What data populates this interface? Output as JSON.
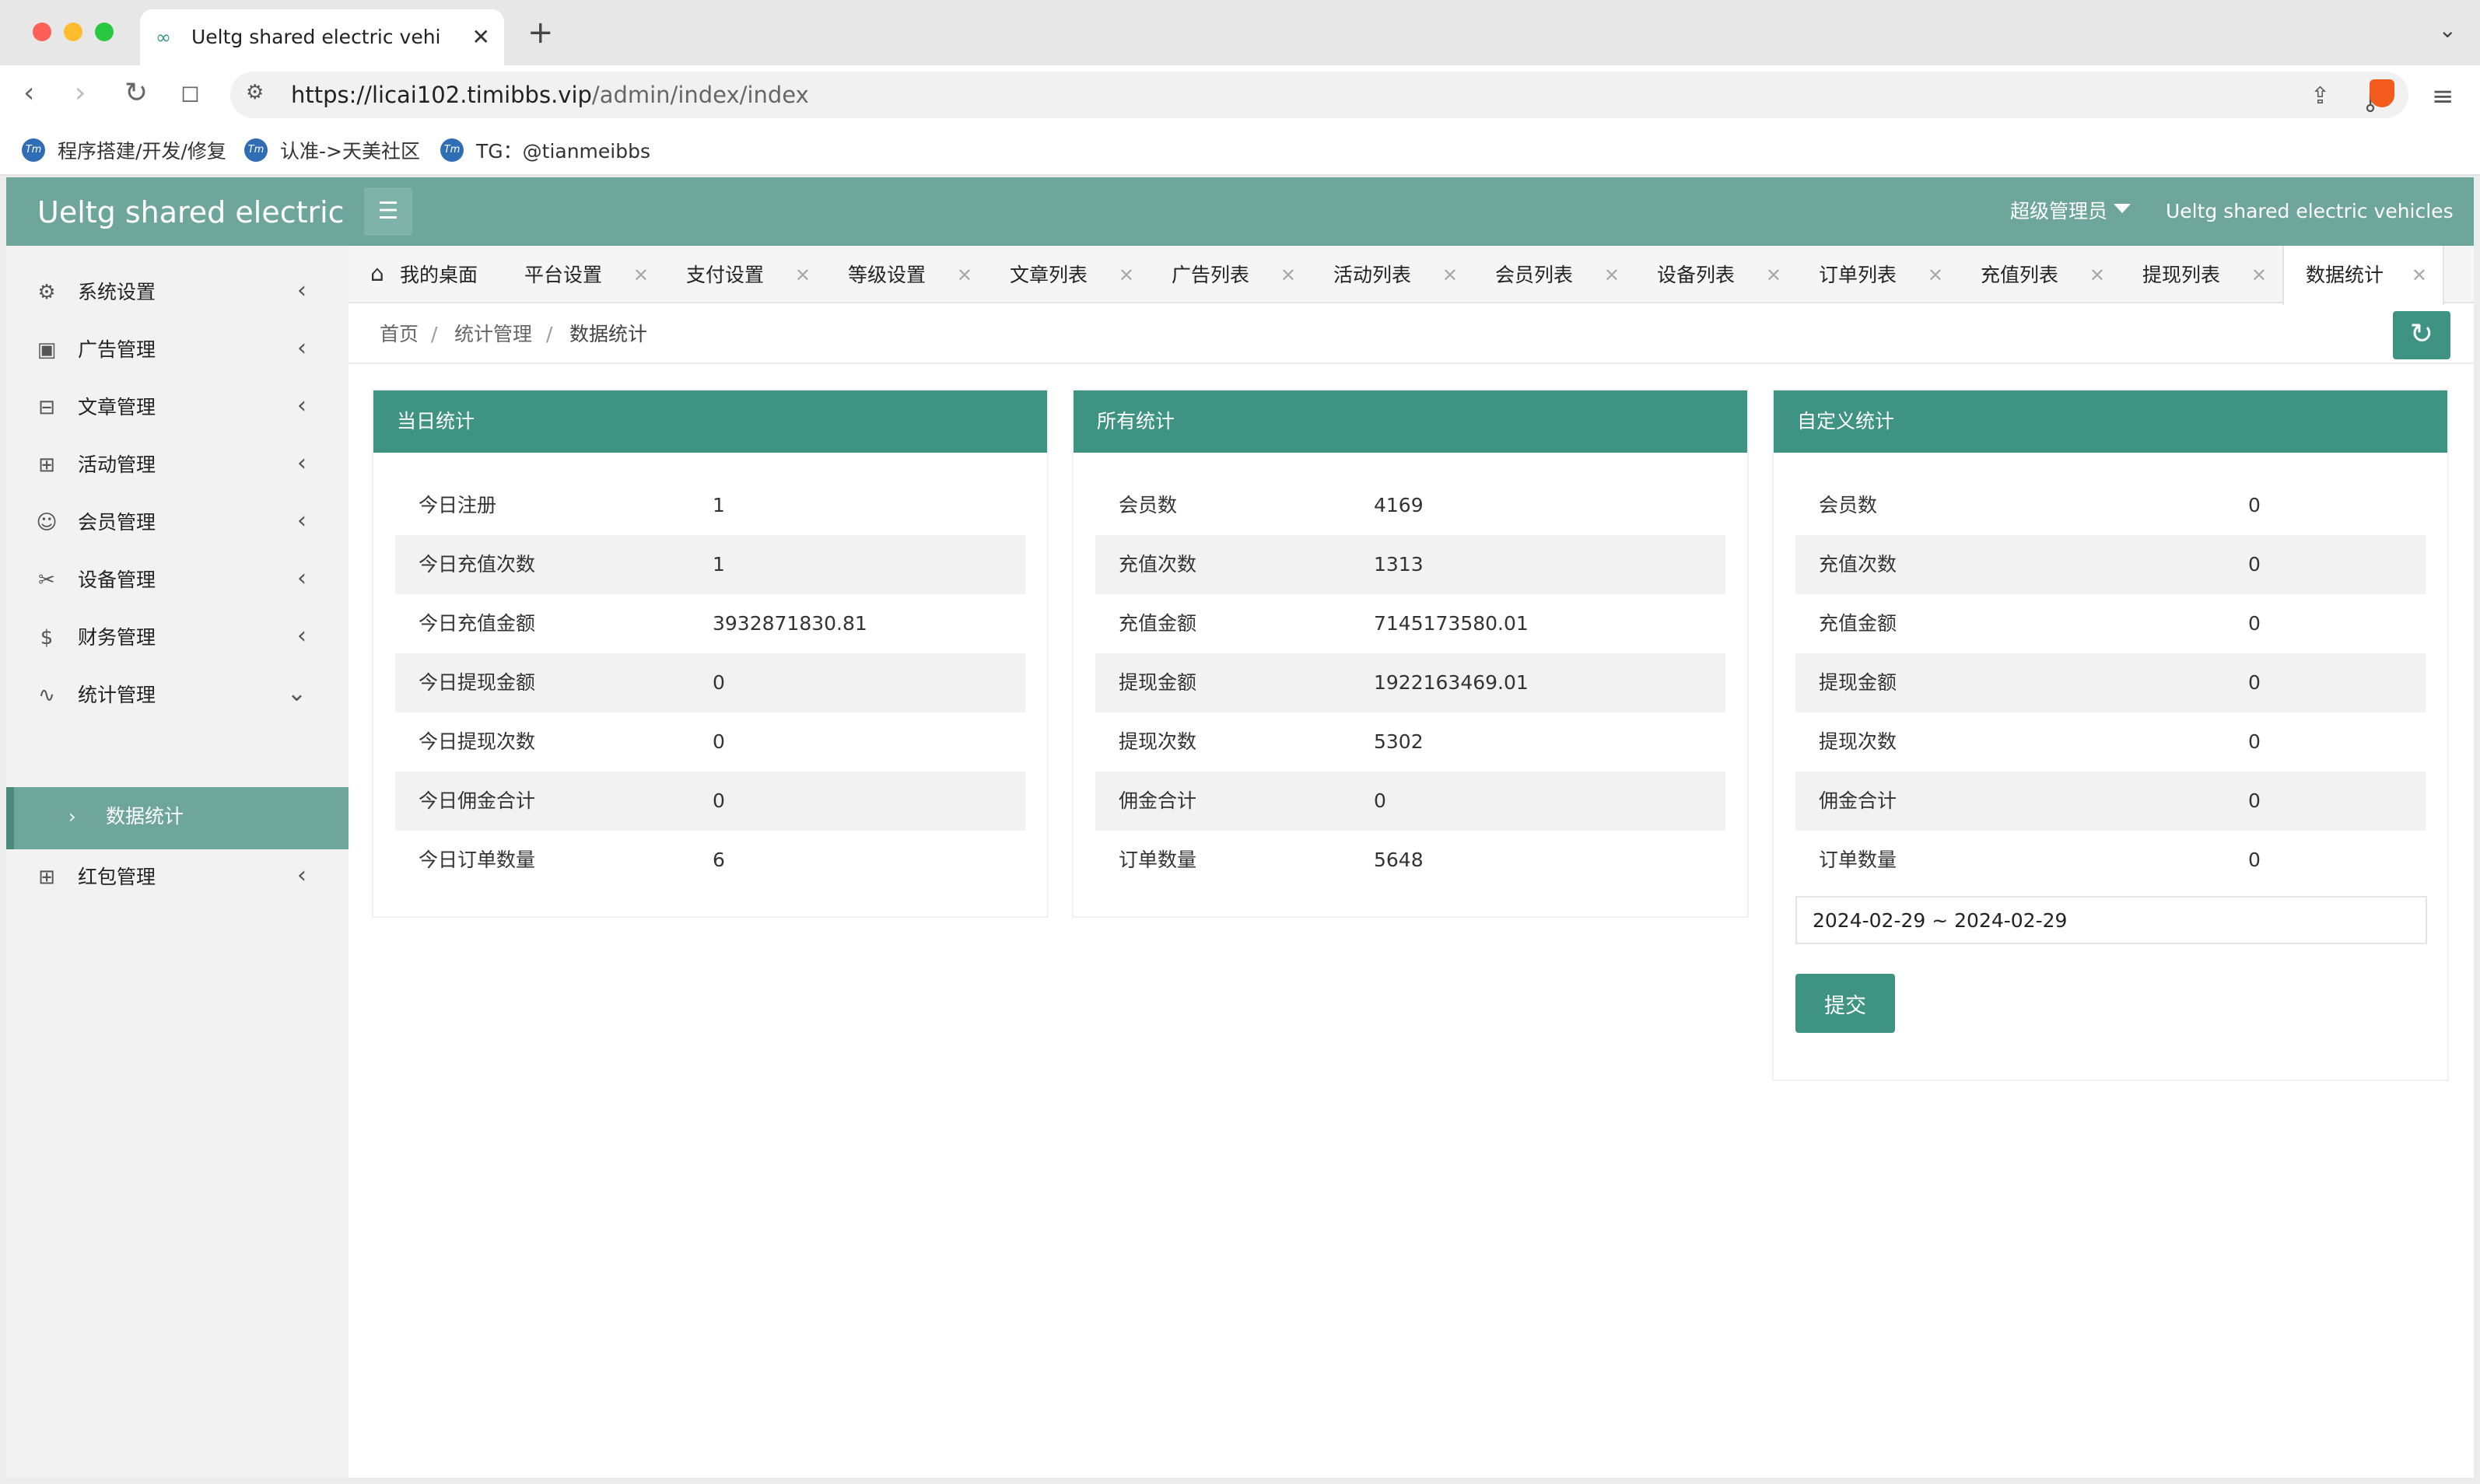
{
  "browser": {
    "tab_title": "Ueltg shared electric vehicles",
    "url_host": "https://licai102.timibbs.vip",
    "url_path": "/admin/index/index",
    "bookmarks": [
      {
        "label": "程序搭建/开发/修复",
        "icon": "tm"
      },
      {
        "label": "认准->天美社区",
        "icon": "tm"
      },
      {
        "label": "TG：@tianmeibbs",
        "icon": "tm"
      }
    ]
  },
  "header": {
    "brand": "Ueltg shared electric",
    "user": "超级管理员",
    "site_name": "Ueltg shared electric vehicles"
  },
  "sidebar": {
    "items": [
      {
        "label": "系统设置",
        "icon": "gear-icon"
      },
      {
        "label": "广告管理",
        "icon": "image-icon"
      },
      {
        "label": "文章管理",
        "icon": "book-icon"
      },
      {
        "label": "活动管理",
        "icon": "gift-icon"
      },
      {
        "label": "会员管理",
        "icon": "user-icon"
      },
      {
        "label": "设备管理",
        "icon": "tools-icon"
      },
      {
        "label": "财务管理",
        "icon": "dollar-icon"
      },
      {
        "label": "统计管理",
        "icon": "pulse-icon"
      },
      {
        "label": "红包管理",
        "icon": "gift-icon"
      }
    ],
    "active_sub": "数据统计"
  },
  "tabs": [
    {
      "label": "我的桌面"
    },
    {
      "label": "平台设置"
    },
    {
      "label": "支付设置"
    },
    {
      "label": "等级设置"
    },
    {
      "label": "文章列表"
    },
    {
      "label": "广告列表"
    },
    {
      "label": "活动列表"
    },
    {
      "label": "会员列表"
    },
    {
      "label": "设备列表"
    },
    {
      "label": "订单列表"
    },
    {
      "label": "充值列表"
    },
    {
      "label": "提现列表"
    },
    {
      "label": "数据统计"
    }
  ],
  "breadcrumb": [
    "首页",
    "统计管理",
    "数据统计"
  ],
  "panels": {
    "today": {
      "title": "当日统计",
      "rows": [
        {
          "label": "今日注册",
          "value": "1"
        },
        {
          "label": "今日充值次数",
          "value": "1"
        },
        {
          "label": "今日充值金额",
          "value": "3932871830.81"
        },
        {
          "label": "今日提现金额",
          "value": "0"
        },
        {
          "label": "今日提现次数",
          "value": "0"
        },
        {
          "label": "今日佣金合计",
          "value": "0"
        },
        {
          "label": "今日订单数量",
          "value": "6"
        }
      ]
    },
    "all": {
      "title": "所有统计",
      "rows": [
        {
          "label": "会员数",
          "value": "4169"
        },
        {
          "label": "充值次数",
          "value": "1313"
        },
        {
          "label": "充值金额",
          "value": "7145173580.01"
        },
        {
          "label": "提现金额",
          "value": "1922163469.01"
        },
        {
          "label": "提现次数",
          "value": "5302"
        },
        {
          "label": "佣金合计",
          "value": "0"
        },
        {
          "label": "订单数量",
          "value": "5648"
        }
      ]
    },
    "custom": {
      "title": "自定义统计",
      "rows": [
        {
          "label": "会员数",
          "value": "0"
        },
        {
          "label": "充值次数",
          "value": "0"
        },
        {
          "label": "充值金额",
          "value": "0"
        },
        {
          "label": "提现金额",
          "value": "0"
        },
        {
          "label": "提现次数",
          "value": "0"
        },
        {
          "label": "佣金合计",
          "value": "0"
        },
        {
          "label": "订单数量",
          "value": "0"
        }
      ],
      "date_range": "2024-02-29 ~ 2024-02-29",
      "submit_label": "提交"
    }
  },
  "colors": {
    "header": "#6ea69c",
    "panel_header": "#3f9383",
    "sidebar_bg": "#f2f2f2"
  }
}
